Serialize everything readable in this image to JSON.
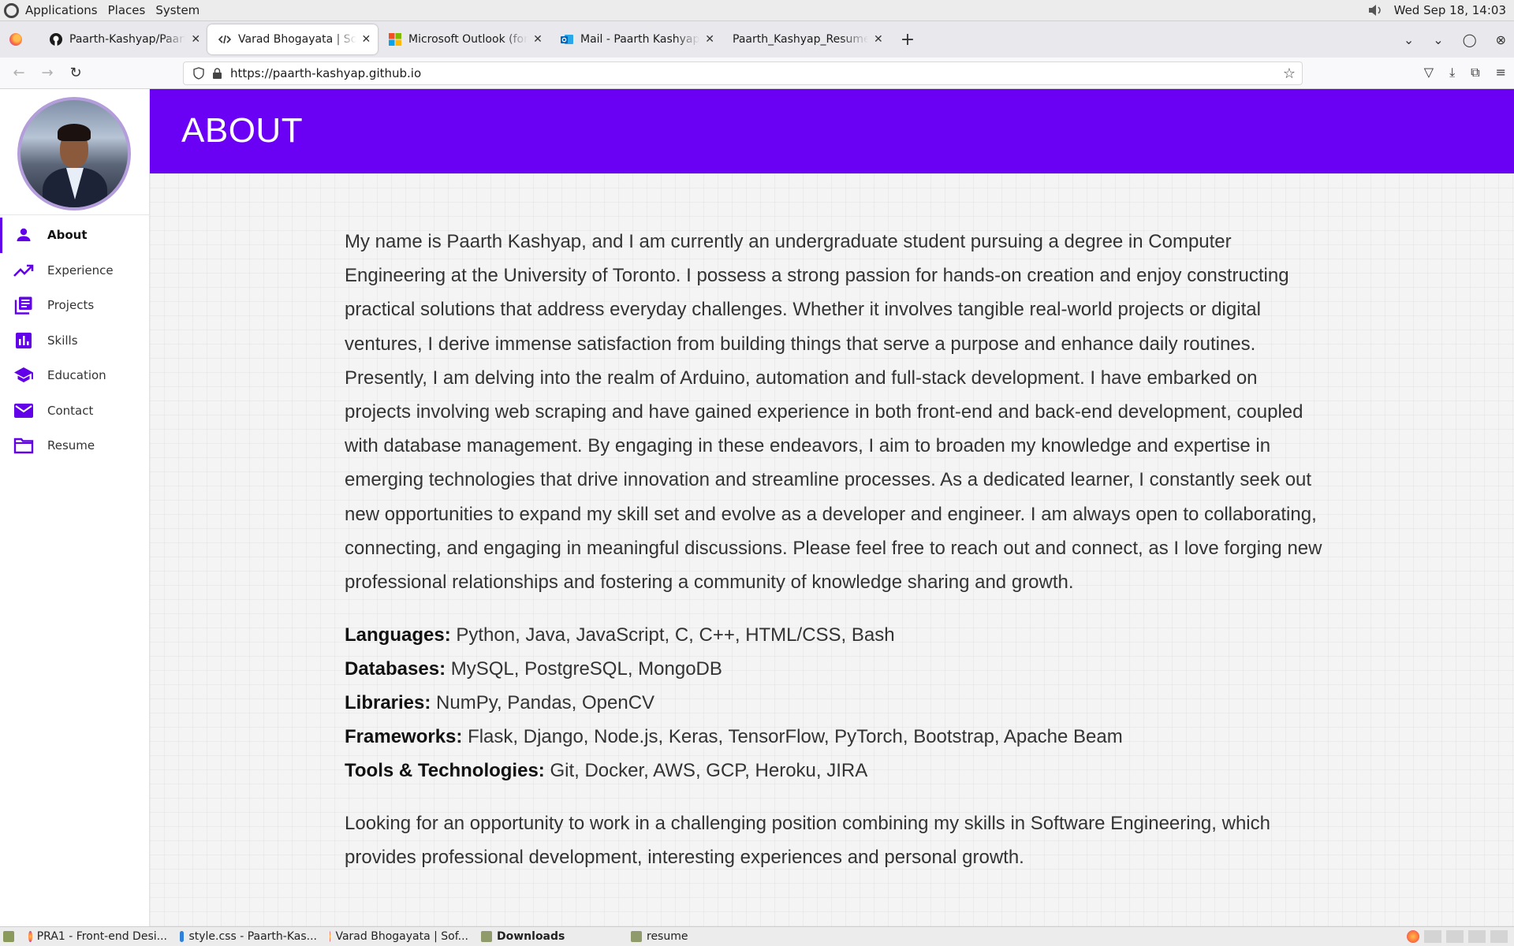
{
  "system_panel": {
    "menus": [
      "Applications",
      "Places",
      "System"
    ],
    "clock": "Wed Sep 18, 14:03"
  },
  "browser": {
    "tabs": [
      {
        "title": "Paarth-Kashyap/Paarth-K",
        "icon": "github-icon",
        "active": false
      },
      {
        "title": "Varad Bhogayata | Softwa",
        "icon": "code-icon",
        "active": true
      },
      {
        "title": "Microsoft Outlook (forme",
        "icon": "microsoft-icon",
        "active": false
      },
      {
        "title": "Mail - Paarth Kashyap - O",
        "icon": "outlook-icon",
        "active": false
      },
      {
        "title": "Paarth_Kashyap_Resume_U",
        "icon": "",
        "active": false
      }
    ],
    "new_tab_label": "+",
    "url": "https://paarth-kashyap.github.io"
  },
  "sidebar": {
    "items": [
      {
        "label": "About",
        "icon": "person-icon",
        "active": true
      },
      {
        "label": "Experience",
        "icon": "trending-up-icon",
        "active": false
      },
      {
        "label": "Projects",
        "icon": "library-books-icon",
        "active": false
      },
      {
        "label": "Skills",
        "icon": "bar-chart-icon",
        "active": false
      },
      {
        "label": "Education",
        "icon": "school-icon",
        "active": false
      },
      {
        "label": "Contact",
        "icon": "mail-icon",
        "active": false
      },
      {
        "label": "Resume",
        "icon": "folder-icon",
        "active": false
      }
    ]
  },
  "main": {
    "title": "ABOUT",
    "bio": "My name is Paarth Kashyap, and I am currently an undergraduate student pursuing a degree in Computer Engineering at the University of Toronto. I possess a strong passion for hands-on creation and enjoy constructing practical solutions that address everyday challenges. Whether it involves tangible real-world projects or digital ventures, I derive immense satisfaction from building things that serve a purpose and enhance daily routines. Presently, I am delving into the realm of Arduino, automation and full-stack development. I have embarked on projects involving web scraping and have gained experience in both front-end and back-end development, coupled with database management. By engaging in these endeavors, I aim to broaden my knowledge and expertise in emerging technologies that drive innovation and streamline processes. As a dedicated learner, I constantly seek out new opportunities to expand my skill set and evolve as a developer and engineer. I am always open to collaborating, connecting, and engaging in meaningful discussions. Please feel free to reach out and connect, as I love forging new professional relationships and fostering a community of knowledge sharing and growth.",
    "skills": [
      {
        "label": "Languages:",
        "value": "Python, Java, JavaScript, C, C++, HTML/CSS, Bash"
      },
      {
        "label": "Databases:",
        "value": "MySQL, PostgreSQL, MongoDB"
      },
      {
        "label": "Libraries:",
        "value": "NumPy, Pandas, OpenCV"
      },
      {
        "label": "Frameworks:",
        "value": "Flask, Django, Node.js, Keras, TensorFlow, PyTorch, Bootstrap, Apache Beam"
      },
      {
        "label": "Tools & Technologies:",
        "value": "Git, Docker, AWS, GCP, Heroku, JIRA"
      }
    ],
    "goal": "Looking for an opportunity to work in a challenging position combining my skills in Software Engineering, which provides professional development, interesting experiences and personal growth."
  },
  "taskbar": {
    "items": [
      {
        "label": "PRA1 - Front-end Desi...",
        "icon": "firefox-icon"
      },
      {
        "label": "style.css - Paarth-Kas...",
        "icon": "vscode-icon"
      },
      {
        "label": "Varad Bhogayata | Sof...",
        "icon": "firefox-icon"
      },
      {
        "label": "Downloads",
        "icon": "folder-icon"
      },
      {
        "label": "resume",
        "icon": "folder-icon"
      }
    ]
  },
  "colors": {
    "accent": "#6a00f4",
    "nav_icon": "#6200ea"
  }
}
